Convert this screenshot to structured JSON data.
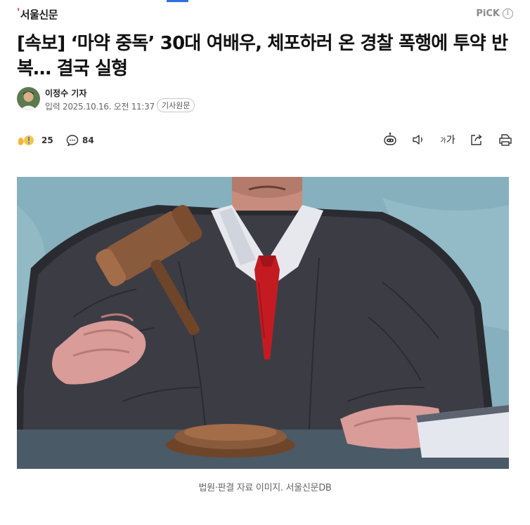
{
  "header": {
    "press_name": "서울신문",
    "pick_label": "PiCK",
    "info_icon": "info-icon"
  },
  "article": {
    "headline": "[속보] ‘마약 중독’ 30대 여배우, 체포하러 온 경찰 폭행에 투약 반복… 결국 실형",
    "reporter": "이정수 기자",
    "date": "입력 2025.10.16. 오전 11:37",
    "origin_button": "기사원문"
  },
  "actions": {
    "reaction_count": "25",
    "comment_count": "84",
    "font_tool_small": "가",
    "font_tool_large": "가",
    "icons": [
      "reaction-icon",
      "comment-icon",
      "summary-bot-icon",
      "audio-icon",
      "font-size-icon",
      "share-icon",
      "print-icon"
    ]
  },
  "photo": {
    "caption": "법원·판결 자료 이미지. 서울신문DB"
  },
  "colors": {
    "accent_blue": "#2f6fe4",
    "logo_dot": "#e02a2a",
    "photo_bg": "#8fb8c4",
    "robe": "#3c3d44",
    "tie": "#c41b22",
    "gavel": "#8a5a3c"
  }
}
